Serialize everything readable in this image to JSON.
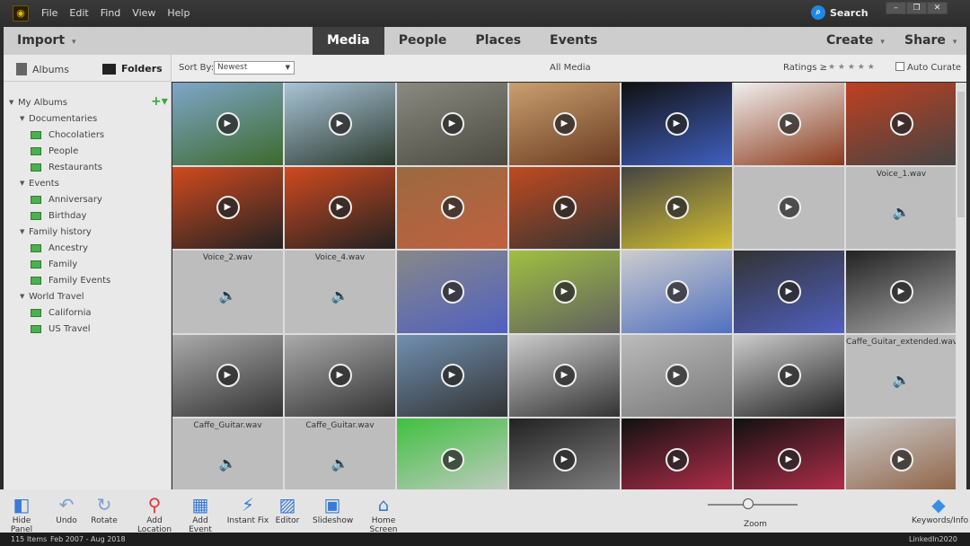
{
  "titlebar": {
    "menu": [
      "File",
      "Edit",
      "Find",
      "View",
      "Help"
    ],
    "search": "Search"
  },
  "nav": {
    "import": "Import",
    "tabs": [
      "Media",
      "People",
      "Places",
      "Events"
    ],
    "active": "Media",
    "create": "Create",
    "share": "Share"
  },
  "left": {
    "tabs": [
      "Albums",
      "Folders"
    ],
    "tree": [
      {
        "label": "My Albums",
        "level": 0,
        "type": "group"
      },
      {
        "label": "Documentaries",
        "level": 1,
        "type": "group"
      },
      {
        "label": "Chocolatiers",
        "level": 2,
        "type": "album"
      },
      {
        "label": "People",
        "level": 2,
        "type": "album"
      },
      {
        "label": "Restaurants",
        "level": 2,
        "type": "album"
      },
      {
        "label": "Events",
        "level": 1,
        "type": "group"
      },
      {
        "label": "Anniversary",
        "level": 2,
        "type": "album"
      },
      {
        "label": "Birthday",
        "level": 2,
        "type": "album"
      },
      {
        "label": "Family history",
        "level": 1,
        "type": "group"
      },
      {
        "label": "Ancestry",
        "level": 2,
        "type": "album"
      },
      {
        "label": "Family",
        "level": 2,
        "type": "album"
      },
      {
        "label": "Family Events",
        "level": 2,
        "type": "album"
      },
      {
        "label": "World Travel",
        "level": 1,
        "type": "group"
      },
      {
        "label": "California",
        "level": 2,
        "type": "album"
      },
      {
        "label": "US Travel",
        "level": 2,
        "type": "album"
      }
    ]
  },
  "toolbar": {
    "sort_label": "Sort By:",
    "sort_value": "Newest",
    "title": "All Media",
    "ratings": "Ratings ≥",
    "stars": "★ ★ ★ ★ ★",
    "auto_curate": "Auto Curate"
  },
  "grid": [
    {
      "t": "v",
      "c": "#7fa6c9,#3d6a2e"
    },
    {
      "t": "v",
      "c": "#a9c4d8,#2c3a2c"
    },
    {
      "t": "v",
      "c": "#8a8a80,#4a4a40"
    },
    {
      "t": "v",
      "c": "#c9a070,#6a3a20"
    },
    {
      "t": "v",
      "c": "#111,#4060c0"
    },
    {
      "t": "v",
      "c": "#f0f0f0,#8a3a1a"
    },
    {
      "t": "v",
      "c": "#c04020,#444"
    },
    {
      "t": "v",
      "c": "#d04a20,#222"
    },
    {
      "t": "v",
      "c": "#d04a20,#222"
    },
    {
      "t": "v",
      "c": "#9a6a40,#c06040"
    },
    {
      "t": "v",
      "c": "#c04a20,#333"
    },
    {
      "t": "v",
      "c": "#444,#d4c030"
    },
    {
      "t": "g"
    },
    {
      "t": "a",
      "label": "Voice_1.wav"
    },
    {
      "t": "a",
      "label": "Voice_2.wav"
    },
    {
      "t": "a",
      "label": "Voice_4.wav"
    },
    {
      "t": "v",
      "c": "#888,#5060c0"
    },
    {
      "t": "v",
      "c": "#a0c040,#606060"
    },
    {
      "t": "v",
      "c": "#ccc,#5070c0"
    },
    {
      "t": "v",
      "c": "#333,#5060c0"
    },
    {
      "t": "v",
      "c": "#222,#aaa"
    },
    {
      "t": "v",
      "c": "#aaa,#333"
    },
    {
      "t": "v",
      "c": "#aaa,#333"
    },
    {
      "t": "v",
      "c": "#7090b0,#333"
    },
    {
      "t": "v",
      "c": "#ccc,#333"
    },
    {
      "t": "v",
      "c": "#bbb,#777"
    },
    {
      "t": "v",
      "c": "#ccc,#222"
    },
    {
      "t": "a",
      "label": "Caffe_Guitar_extended.wav"
    },
    {
      "t": "a",
      "label": "Caffe_Guitar.wav"
    },
    {
      "t": "a",
      "label": "Caffe_Guitar.wav"
    },
    {
      "t": "v",
      "c": "#40c040,#ccc"
    },
    {
      "t": "v",
      "c": "#222,#888"
    },
    {
      "t": "v",
      "c": "#111,#c03050"
    },
    {
      "t": "v",
      "c": "#111,#c03050"
    },
    {
      "t": "v",
      "c": "#ccc,#8a5a3a"
    }
  ],
  "bottom": {
    "tools": [
      "Hide Panel",
      "Undo",
      "Rotate",
      "Add Location",
      "Add Event",
      "Instant Fix",
      "Editor",
      "Slideshow",
      "Home Screen"
    ],
    "zoom": "Zoom",
    "zoom_level": 0.45,
    "keywords": "Keywords/Info"
  },
  "status": {
    "items": "115 Items",
    "range": "Feb 2007 - Aug 2018",
    "watermark": "LinkedIn2020"
  },
  "colors": {
    "accent": "#1e88e5",
    "album": "#4caf50",
    "active_tab": "#3f3f3f"
  }
}
